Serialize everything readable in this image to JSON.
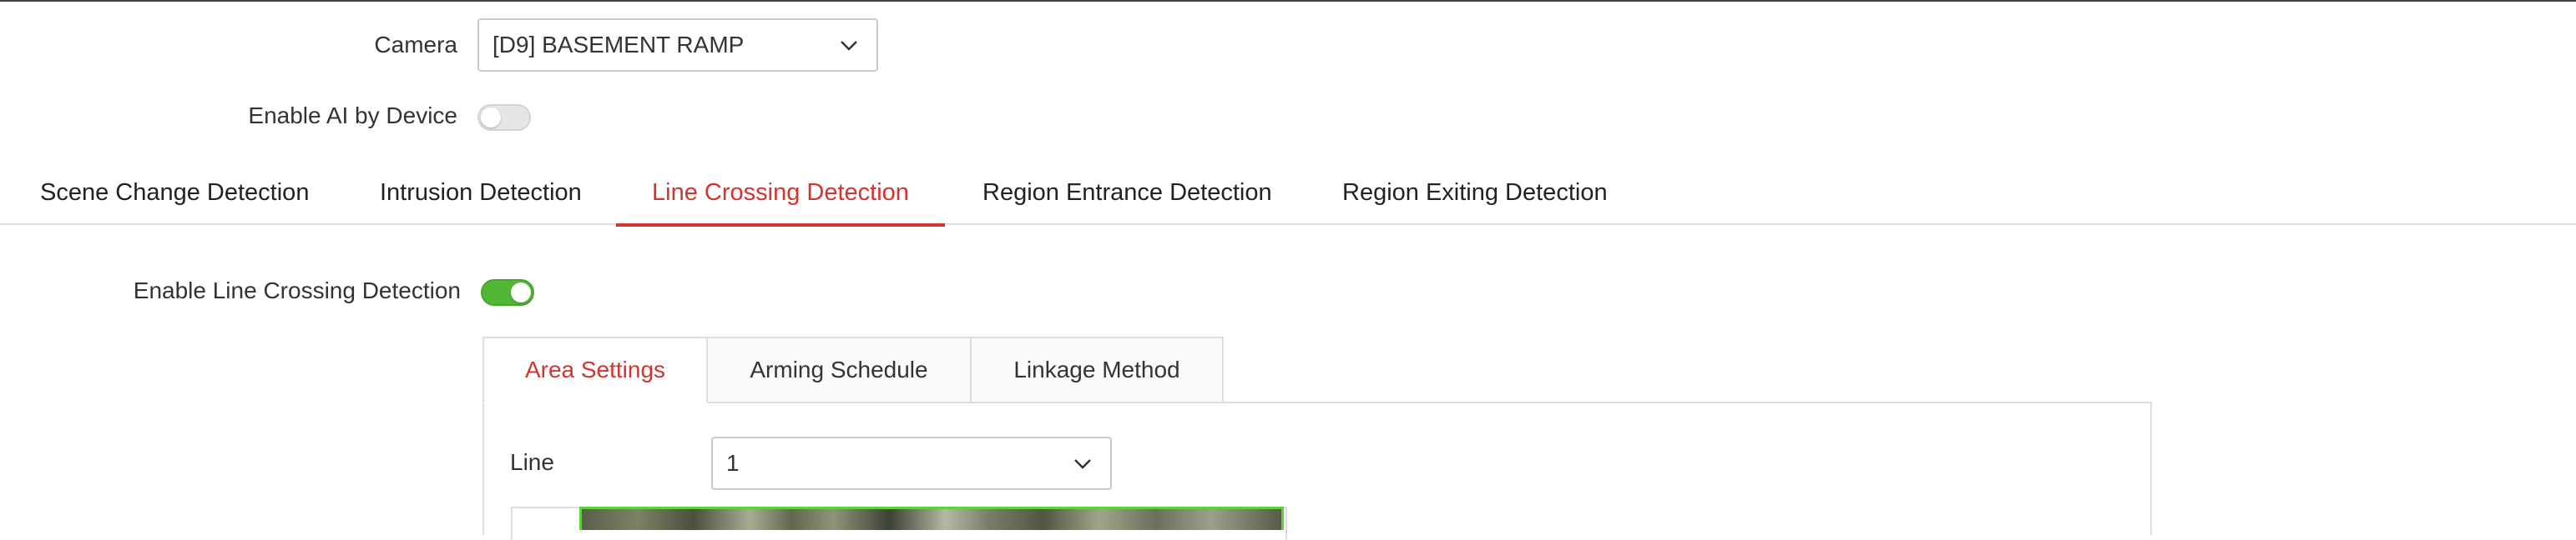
{
  "camera": {
    "label": "Camera",
    "selected": "[D9] BASEMENT RAMP"
  },
  "enable_ai": {
    "label": "Enable AI by Device",
    "state": "off"
  },
  "main_tabs": [
    {
      "label": "Scene Change Detection",
      "active": false
    },
    {
      "label": "Intrusion Detection",
      "active": false
    },
    {
      "label": "Line Crossing Detection",
      "active": true
    },
    {
      "label": "Region Entrance Detection",
      "active": false
    },
    {
      "label": "Region Exiting Detection",
      "active": false
    }
  ],
  "enable_line_crossing": {
    "label": "Enable Line Crossing Detection",
    "state": "on"
  },
  "sub_tabs": [
    {
      "label": "Area Settings",
      "active": true
    },
    {
      "label": "Arming Schedule",
      "active": false
    },
    {
      "label": "Linkage Method",
      "active": false
    }
  ],
  "line": {
    "label": "Line",
    "selected": "1"
  },
  "colors": {
    "accent_red": "#d5332f",
    "toggle_on": "#52b734",
    "preview_border": "#5ed13b"
  }
}
